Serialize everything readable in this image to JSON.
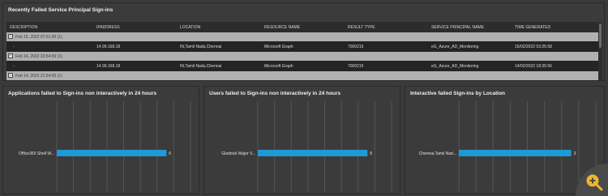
{
  "table_panel": {
    "title": "Recently Failed Service Principal Sign-ins",
    "columns": [
      "DESCRIPTION",
      "IPADDRESS",
      "LOCATION",
      "RESOURCE NAME",
      "RESULT TYPE",
      "SERVICE PRINCIPAL NAME",
      "TIME GENERATED"
    ],
    "groups": [
      {
        "label": "Feb 15, 2022 07:01:00 (1)",
        "rows": [
          [
            "-",
            "14.99.168.18",
            "IN,Tamil Nadu,Chennai",
            "Microsoft Graph",
            "7000215",
            "eG_Azure_AD_Monitoring",
            "15/02/2022 03:25:58"
          ]
        ]
      },
      {
        "label": "Feb 14, 2022 23:54:00 (1)",
        "rows": [
          [
            "-",
            "14.99.168.18",
            "IN,Tamil Nadu,Chennai",
            "Microsoft Graph",
            "7000215",
            "eG_Azure_AD_Monitoring",
            "14/02/2022 18:35:56"
          ]
        ]
      },
      {
        "label": "Feb 14, 2022 21:54:00 (1)",
        "rows": []
      }
    ]
  },
  "chart_data": [
    {
      "type": "bar",
      "orientation": "horizontal",
      "title": "Applications failed to Sign-ins non interactively in 24 hours",
      "categories": [
        "Office365 Shell W..."
      ],
      "values": [
        6
      ],
      "color": "#1e9ad6",
      "grid": true
    },
    {
      "type": "bar",
      "orientation": "horizontal",
      "title": "Users failed to Sign-ins non interactively in 24 hours",
      "categories": [
        "Gladnick Major V..."
      ],
      "values": [
        8
      ],
      "color": "#1e9ad6",
      "grid": true
    },
    {
      "type": "bar",
      "orientation": "horizontal",
      "title": "Interactive failed Sign-ins by Location",
      "categories": [
        "Chennai,Tamil Nad..."
      ],
      "values": [
        3
      ],
      "color": "#1e9ad6",
      "grid": true
    }
  ],
  "zoom_button": {
    "icon": "zoom-in-icon"
  }
}
